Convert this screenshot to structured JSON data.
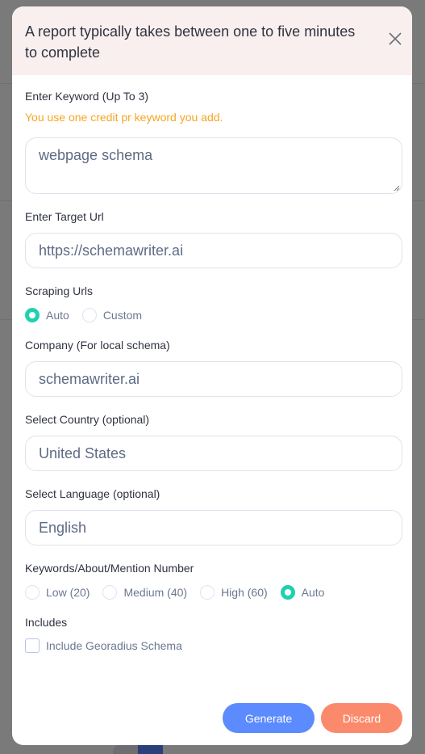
{
  "modal": {
    "header_text": "A report typically takes between one to five minutes to complete",
    "close_icon": "close-icon"
  },
  "keyword": {
    "label": "Enter Keyword (Up To 3)",
    "hint": "You use one credit pr keyword you add.",
    "value": "webpage schema"
  },
  "target_url": {
    "label": "Enter Target Url",
    "value": "https://schemawriter.ai"
  },
  "scraping_urls": {
    "label": "Scraping Urls",
    "options": [
      {
        "label": "Auto",
        "checked": true
      },
      {
        "label": "Custom",
        "checked": false
      }
    ]
  },
  "company": {
    "label": "Company (For local schema)",
    "value": "schemawriter.ai"
  },
  "country": {
    "label": "Select Country (optional)",
    "value": "United States"
  },
  "language": {
    "label": "Select Language (optional)",
    "value": "English"
  },
  "mention_number": {
    "label": "Keywords/About/Mention Number",
    "options": [
      {
        "label": "Low (20)",
        "checked": false
      },
      {
        "label": "Medium (40)",
        "checked": false
      },
      {
        "label": "High (60)",
        "checked": false
      },
      {
        "label": "Auto",
        "checked": true
      }
    ]
  },
  "includes": {
    "label": "Includes",
    "checkbox_label": "Include Georadius Schema",
    "checked": false
  },
  "actions": {
    "generate_label": "Generate",
    "discard_label": "Discard"
  },
  "colors": {
    "accent_radio": "#1fd1b0",
    "generate": "#5b8bfe",
    "discard": "#fb8a6c",
    "hint": "#f6a623",
    "header_bg": "#f9efee"
  }
}
